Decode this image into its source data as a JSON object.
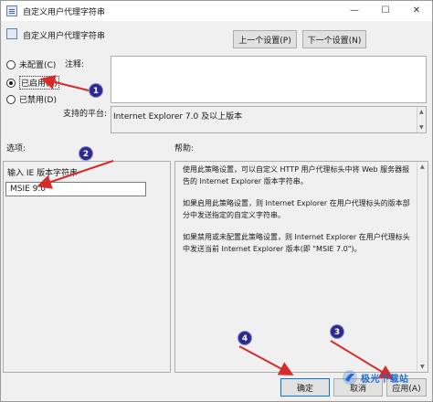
{
  "window": {
    "title": "自定义用户代理字符串",
    "controls": {
      "minimize": "—",
      "maximize": "☐",
      "close": "✕"
    }
  },
  "header": {
    "title": "自定义用户代理字符串",
    "prev_button": "上一个设置(P)",
    "next_button": "下一个设置(N)"
  },
  "state": {
    "options": [
      {
        "label": "未配置(C)",
        "checked": false
      },
      {
        "label": "已启用(E)",
        "checked": true
      },
      {
        "label": "已禁用(D)",
        "checked": false
      }
    ]
  },
  "comment": {
    "label": "注释:",
    "value": ""
  },
  "platform": {
    "label": "支持的平台:",
    "value": "Internet Explorer 7.0 及以上版本"
  },
  "options": {
    "label": "选项:",
    "caption": "输入 IE 版本字符串",
    "value": "MSIE 9.0"
  },
  "help": {
    "label": "帮助:",
    "paragraphs": [
      "使用此策略设置，可以自定义 HTTP 用户代理标头中将 Web 服务器报告的 Internet Explorer 版本字符串。",
      "如果启用此策略设置，则 Internet Explorer 在用户代理标头的版本部分中发送指定的自定义字符串。",
      "如果禁用或未配置此策略设置，则 Internet Explorer 在用户代理标头中发送当前 Internet Explorer 版本(即 \"MSIE 7.0\")。"
    ]
  },
  "footer": {
    "ok_button": "确定",
    "cancel_button": "取消",
    "apply_button": "应用(A)"
  },
  "annotations": {
    "markers": [
      "1",
      "2",
      "3",
      "4"
    ],
    "arrow_color": "#d62b2b",
    "marker_color": "#2d2a8c"
  },
  "watermark": {
    "text": "极光下载站"
  }
}
